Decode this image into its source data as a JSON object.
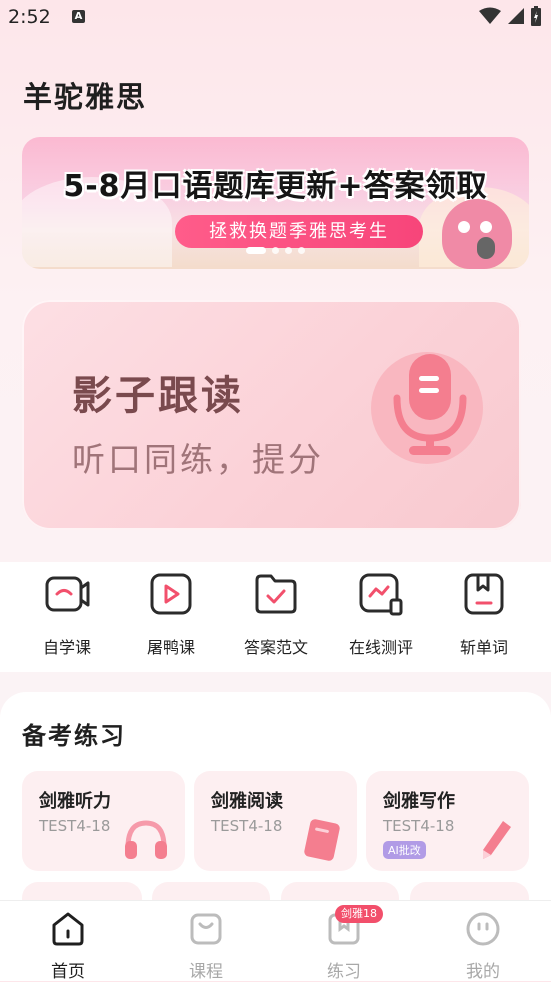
{
  "status_bar": {
    "time": "2:52",
    "notification_icon": "A"
  },
  "app": {
    "title": "羊驼雅思"
  },
  "banner": {
    "headline": "5-8月口语题库更新+答案领取",
    "button": "拯救换题季雅思考生",
    "slides": 4,
    "active_slide": 0
  },
  "shadow_card": {
    "title": "影子跟读",
    "subtitle": "听口同练，提分"
  },
  "shortcuts": [
    {
      "label": "自学课",
      "icon": "video-camera-icon"
    },
    {
      "label": "屠鸭课",
      "icon": "play-icon"
    },
    {
      "label": "答案范文",
      "icon": "folder-check-icon"
    },
    {
      "label": "在线测评",
      "icon": "chart-icon"
    },
    {
      "label": "斩单词",
      "icon": "bookmark-icon"
    }
  ],
  "practice": {
    "title": "备考练习",
    "items": [
      {
        "title": "剑雅听力",
        "sub": "TEST4-18",
        "badge": "",
        "icon": "headphones-icon"
      },
      {
        "title": "剑雅阅读",
        "sub": "TEST4-18",
        "badge": "",
        "icon": "book-icon"
      },
      {
        "title": "剑雅写作",
        "sub": "TEST4-18",
        "badge": "AI批改",
        "icon": "pen-icon"
      }
    ]
  },
  "nav": {
    "items": [
      {
        "label": "首页",
        "icon": "home-icon",
        "active": true
      },
      {
        "label": "课程",
        "icon": "bag-icon",
        "active": false
      },
      {
        "label": "练习",
        "icon": "book-open-icon",
        "active": false
      },
      {
        "label": "我的",
        "icon": "smile-icon",
        "active": false
      }
    ],
    "badge": "剑雅18"
  },
  "colors": {
    "accent": "#f24f6b",
    "card_pink": "#fdeff1",
    "text_muted": "#9a9a9a"
  }
}
